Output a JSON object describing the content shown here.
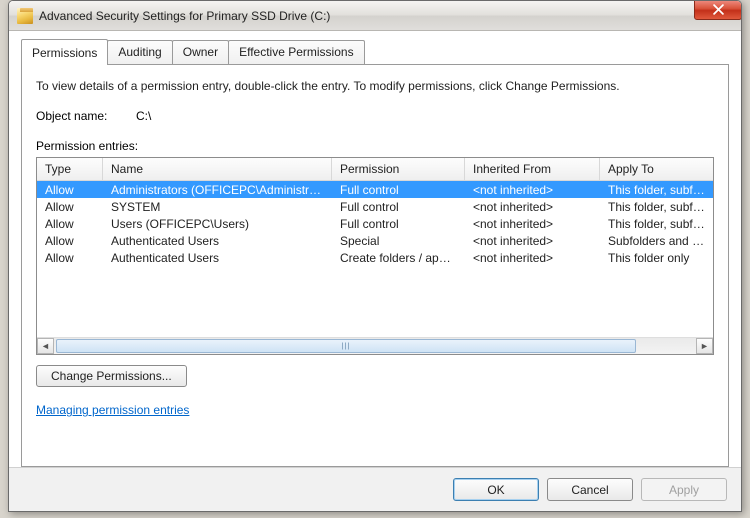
{
  "window": {
    "title": "Advanced Security Settings for Primary SSD Drive (C:)"
  },
  "tabs": [
    {
      "label": "Permissions",
      "active": true
    },
    {
      "label": "Auditing",
      "active": false
    },
    {
      "label": "Owner",
      "active": false
    },
    {
      "label": "Effective Permissions",
      "active": false
    }
  ],
  "content": {
    "instruction": "To view details of a permission entry, double-click the entry. To modify permissions, click Change Permissions.",
    "object_name_label": "Object name:",
    "object_name_value": "C:\\",
    "entries_label": "Permission entries:",
    "columns": [
      "Type",
      "Name",
      "Permission",
      "Inherited From",
      "Apply To"
    ],
    "rows": [
      {
        "type": "Allow",
        "name": "Administrators (OFFICEPC\\Administrato...",
        "perm": "Full control",
        "inh": "<not inherited>",
        "apply": "This folder, subfolde",
        "selected": true
      },
      {
        "type": "Allow",
        "name": "SYSTEM",
        "perm": "Full control",
        "inh": "<not inherited>",
        "apply": "This folder, subfolde",
        "selected": false
      },
      {
        "type": "Allow",
        "name": "Users (OFFICEPC\\Users)",
        "perm": "Full control",
        "inh": "<not inherited>",
        "apply": "This folder, subfolde",
        "selected": false
      },
      {
        "type": "Allow",
        "name": "Authenticated Users",
        "perm": "Special",
        "inh": "<not inherited>",
        "apply": "Subfolders and files",
        "selected": false
      },
      {
        "type": "Allow",
        "name": "Authenticated Users",
        "perm": "Create folders / appe...",
        "inh": "<not inherited>",
        "apply": "This folder only",
        "selected": false
      }
    ],
    "change_button": "Change Permissions...",
    "link": "Managing permission entries"
  },
  "footer": {
    "ok": "OK",
    "cancel": "Cancel",
    "apply": "Apply"
  }
}
